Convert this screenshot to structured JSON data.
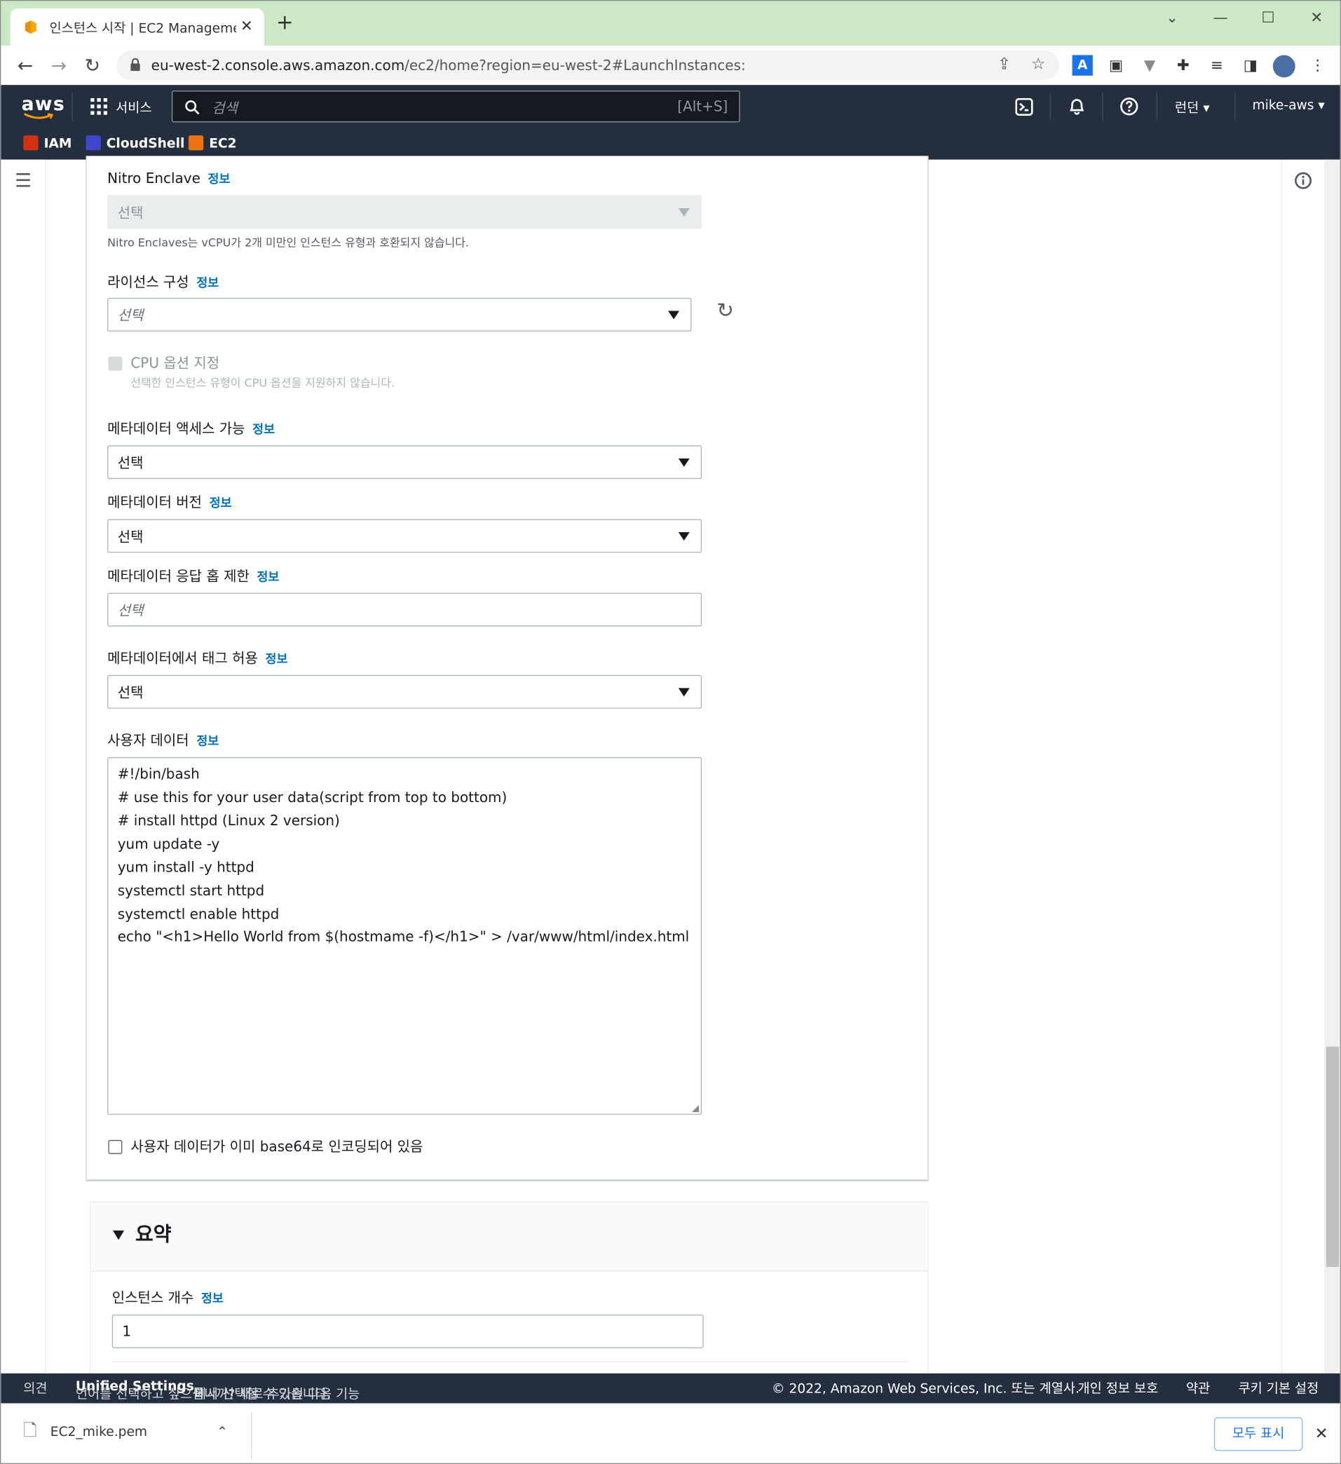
{
  "browser": {
    "tab_title": "인스턴스 시작 | EC2 Management",
    "url_host": "eu-west-2.console.aws.amazon.com",
    "url_path": "/ec2/home?region=eu-west-2#LaunchInstances:"
  },
  "aws_nav": {
    "logo": "aws",
    "services_label": "서비스",
    "search_placeholder": "검색",
    "search_shortcut": "[Alt+S]",
    "region": "런던",
    "account": "mike-aws",
    "favorites": [
      {
        "label": "IAM",
        "color": "#d13212"
      },
      {
        "label": "CloudShell",
        "color": "#3f48cc"
      },
      {
        "label": "EC2",
        "color": "#ec7211"
      }
    ]
  },
  "form": {
    "info_label": "정보",
    "nitro_label": "Nitro Enclave",
    "nitro_value": "선택",
    "nitro_hint": "Nitro Enclaves는 vCPU가 2개 미만인 인스턴스 유형과 호환되지 않습니다.",
    "license_label": "라이선스 구성",
    "license_placeholder": "선택",
    "cpu_label": "CPU 옵션 지정",
    "cpu_hint": "선택한 인스턴스 유형이 CPU 옵션을 지원하지 않습니다.",
    "metadata_access_label": "메타데이터 액세스 가능",
    "metadata_access_value": "선택",
    "metadata_version_label": "메타데이터 버전",
    "metadata_version_value": "선택",
    "metadata_hop_label": "메타데이터 응답 홉 제한",
    "metadata_hop_placeholder": "선택",
    "metadata_tags_label": "메타데이터에서 태그 허용",
    "metadata_tags_value": "선택",
    "userdata_label": "사용자 데이터",
    "userdata_lines": [
      "#!/bin/bash",
      "# use this for your user data(script from top to bottom)",
      "# install httpd (Linux 2 version)",
      "yum update -y",
      "yum install -y httpd",
      "systemctl start httpd",
      "systemctl enable httpd",
      "echo \"<h1>Hello World from $(hostmame -f)</h1>\" > /var/www/html/index.html"
    ],
    "base64_label": "사용자 데이터가 이미 base64로 인코딩되어 있음"
  },
  "summary": {
    "title": "요약",
    "instance_count_label": "인스턴스 개수",
    "instance_count_value": "1"
  },
  "footer": {
    "feedback": "의견",
    "lang_notice": "언어를 선택하고 싶으십니까? 새로 추가된 다음 기능",
    "unified": "Unified Settings",
    "lang_notice2": "에서 선택할 수 있습니다.",
    "copyright": "© 2022, Amazon Web Services, Inc. 또는 계열사.",
    "privacy": "개인 정보 보호",
    "terms": "약관",
    "cookies": "쿠키 기본 설정"
  },
  "download": {
    "filename": "EC2_mike.pem",
    "show_all": "모두 표시"
  }
}
